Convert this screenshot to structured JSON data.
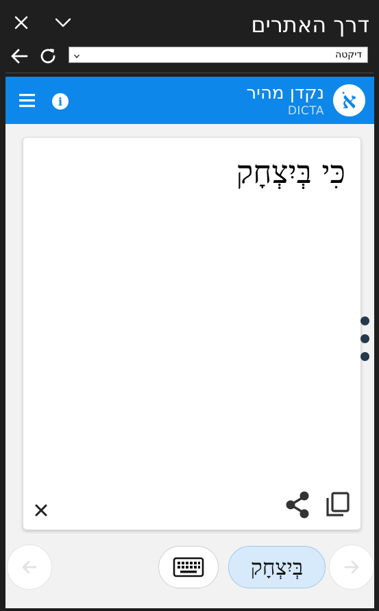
{
  "window": {
    "title": "דרך האתרים",
    "close_icon": "close-icon",
    "dropdown_icon": "chevron-down-icon"
  },
  "navbar": {
    "back_icon": "back-arrow-icon",
    "reload_icon": "reload-icon",
    "address_value": "דיקטה"
  },
  "app": {
    "title": "נקדן מהיר",
    "subtitle": "DICTA",
    "logo_letter": "אֹ",
    "info_symbol": "i",
    "brand_color": "#0d87e9"
  },
  "editor": {
    "text": "כִּי בְּיִצְחָק"
  },
  "bottom": {
    "selected_word": "בְּיִצְחָק",
    "prev_icon": "arrow-left-icon",
    "next_icon": "arrow-right-icon",
    "keyboard_icon": "keyboard-icon"
  }
}
